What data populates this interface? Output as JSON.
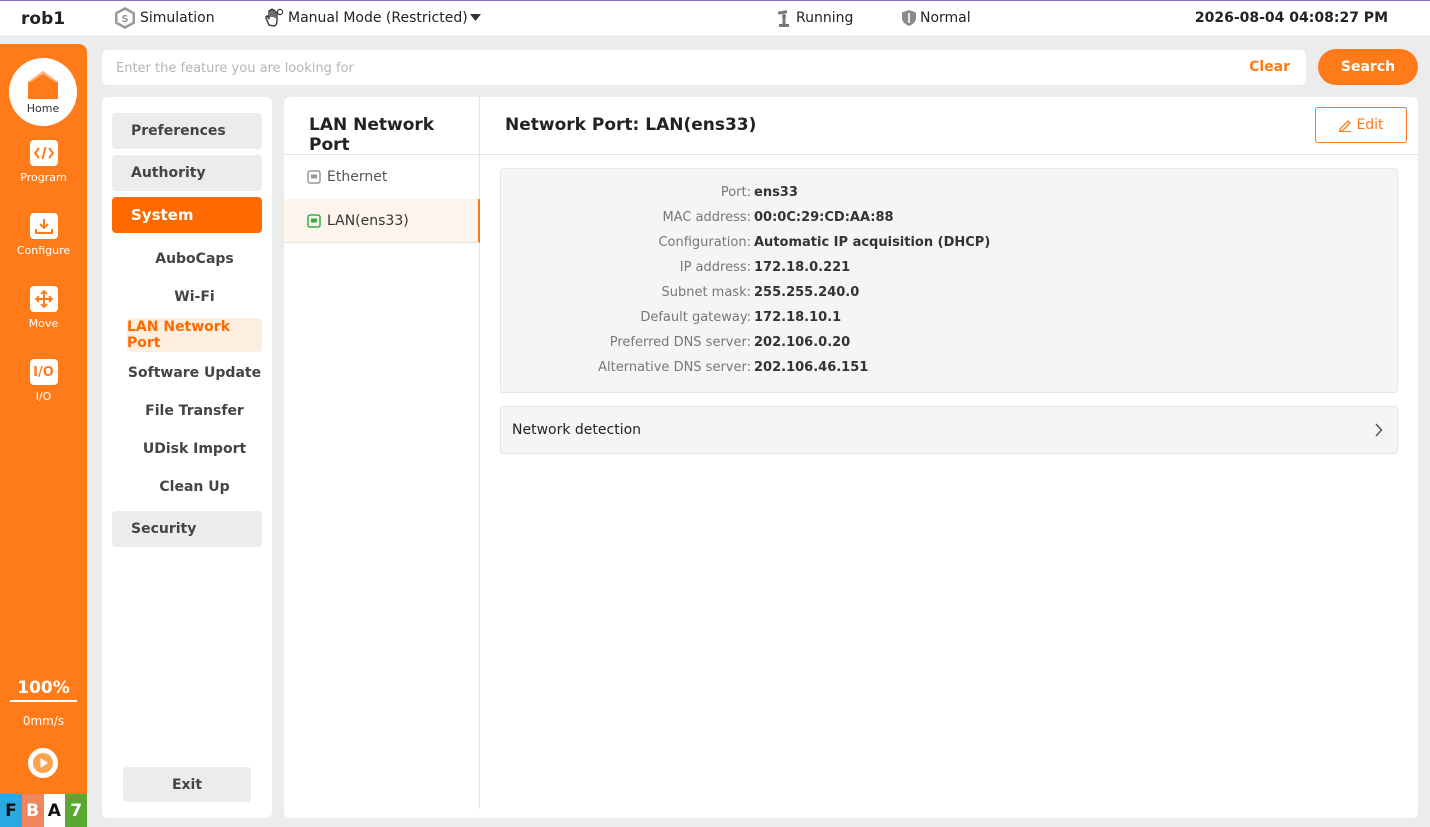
{
  "topbar": {
    "robot_name": "rob1",
    "sim_label": "Simulation",
    "mode_label": "Manual Mode (Restricted)",
    "run_status": "Running",
    "safety_status": "Normal",
    "datetime": "2026-08-04 04:08:27 PM"
  },
  "leftnav": {
    "home": "Home",
    "program": "Program",
    "configure": "Configure",
    "move": "Move",
    "io": "I/O",
    "speed_percent": "100%",
    "speed_value": "0mm/s",
    "badges": [
      "F",
      "B",
      "A",
      "7"
    ]
  },
  "search": {
    "placeholder": "Enter the feature you are looking for",
    "clear": "Clear",
    "button": "Search"
  },
  "settings": {
    "preferences": "Preferences",
    "authority": "Authority",
    "system": "System",
    "sub_items": [
      "AuboCaps",
      "Wi-Fi",
      "LAN Network Port",
      "Software Update",
      "File Transfer",
      "UDisk Import",
      "Clean Up"
    ],
    "security": "Security",
    "exit": "Exit"
  },
  "ports": {
    "title": "LAN Network Port",
    "items": [
      "Ethernet",
      "LAN(ens33)"
    ]
  },
  "detail": {
    "title": "Network Port: LAN(ens33)",
    "edit": "Edit",
    "rows": [
      {
        "label": "Port:",
        "value": "ens33"
      },
      {
        "label": "MAC address:",
        "value": "00:0C:29:CD:AA:88"
      },
      {
        "label": "Configuration:",
        "value": "Automatic IP acquisition (DHCP)"
      },
      {
        "label": "IP address:",
        "value": "172.18.0.221"
      },
      {
        "label": "Subnet mask:",
        "value": "255.255.240.0"
      },
      {
        "label": "Default gateway:",
        "value": "172.18.10.1"
      },
      {
        "label": "Preferred DNS server:",
        "value": "202.106.0.20"
      },
      {
        "label": "Alternative DNS server:",
        "value": "202.106.46.151"
      }
    ],
    "network_detection": "Network detection"
  },
  "colors": {
    "accent": "#ff7b19",
    "badge_f": "#2aa8e0",
    "badge_b": "#f0845a",
    "badge_a": "#ffffff",
    "badge_7": "#5aa832"
  }
}
